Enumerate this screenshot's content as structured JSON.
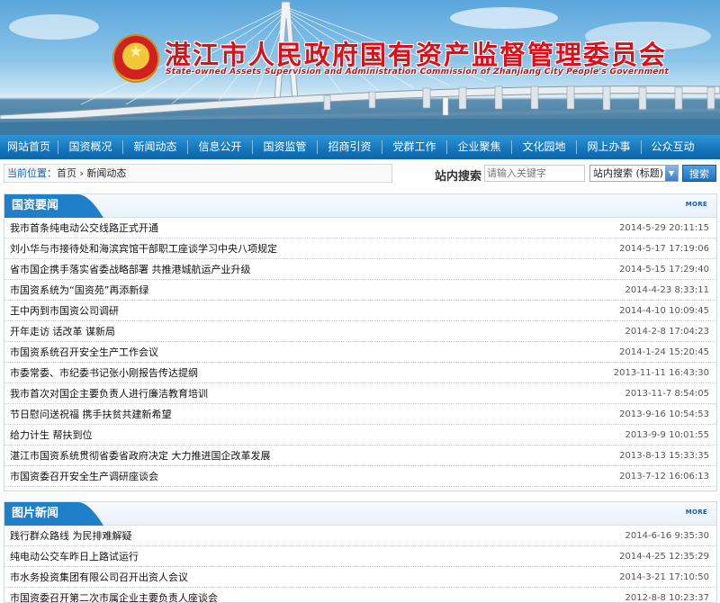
{
  "header": {
    "title": "湛江市人民政府国有资产监督管理委员会",
    "subtitle": "State-owned Assets Supervision and Administration Commission of Zhanjiang City People's Government",
    "emblem_icon": "national-emblem-icon"
  },
  "nav": {
    "items": [
      {
        "label": "网站首页"
      },
      {
        "label": "国资概况"
      },
      {
        "label": "新闻动态"
      },
      {
        "label": "信息公开"
      },
      {
        "label": "国资监管"
      },
      {
        "label": "招商引资"
      },
      {
        "label": "党群工作"
      },
      {
        "label": "企业聚焦"
      },
      {
        "label": "文化园地"
      },
      {
        "label": "网上办事"
      },
      {
        "label": "公众互动"
      }
    ]
  },
  "location": {
    "label": "当前位置：",
    "home": "首页",
    "separator": "›",
    "current": "新闻动态"
  },
  "search": {
    "label": "站内搜索",
    "placeholder": "请输入关键字",
    "select_value": "站内搜索 (标题)",
    "button": "搜索"
  },
  "news_panel": {
    "title": "国资要闻",
    "more": "MORE",
    "items": [
      {
        "title": "我市首条纯电动公交线路正式开通",
        "date": "2014-5-29 20:11:15"
      },
      {
        "title": "刘小华与市接待处和海滨宾馆干部职工座谈学习中央八项规定",
        "date": "2014-5-17 17:19:06"
      },
      {
        "title": "省市国企携手落实省委战略部署 共推港城航运产业升级",
        "date": "2014-5-15 17:29:40"
      },
      {
        "title": "市国资系统为“国资苑”再添新绿",
        "date": "2014-4-23 8:33:11"
      },
      {
        "title": "王中丙到市国资公司调研",
        "date": "2014-4-10 10:09:45"
      },
      {
        "title": "开年走访 话改革 谋新局",
        "date": "2014-2-8 17:04:23"
      },
      {
        "title": "市国资系统召开安全生产工作会议",
        "date": "2014-1-24 15:20:45"
      },
      {
        "title": "市委常委、市纪委书记张小刚报告传达提纲",
        "date": "2013-11-11 16:43:30"
      },
      {
        "title": "我市首次对国企主要负责人进行廉洁教育培训",
        "date": "2013-11-7 8:54:05"
      },
      {
        "title": "节日慰问送祝福 携手扶贫共建新希望",
        "date": "2013-9-16 10:54:53"
      },
      {
        "title": "给力计生 帮扶到位",
        "date": "2013-9-9 10:01:55"
      },
      {
        "title": "湛江市国资系统贯彻省委省政府决定 大力推进国企改革发展",
        "date": "2013-8-13 15:33:35"
      },
      {
        "title": "市国资委召开安全生产调研座谈会",
        "date": "2013-7-12 16:06:13"
      }
    ]
  },
  "photo_panel": {
    "title": "图片新闻",
    "more": "MORE",
    "items": [
      {
        "title": "践行群众路线 为民排难解疑",
        "date": "2014-6-16 9:35:30"
      },
      {
        "title": "纯电动公交车昨日上路试运行",
        "date": "2014-4-25 12:35:29"
      },
      {
        "title": "市水务投资集团有限公司召开出资人会议",
        "date": "2014-3-21 17:10:50"
      },
      {
        "title": "市国资委召开第二次市属企业主要负责人座谈会",
        "date": "2012-8-8 10:23:37"
      }
    ]
  },
  "colors": {
    "nav_blue": "#1677bd",
    "title_red": "#d9111a",
    "panel_tab_blue": "#1f7fc8"
  }
}
